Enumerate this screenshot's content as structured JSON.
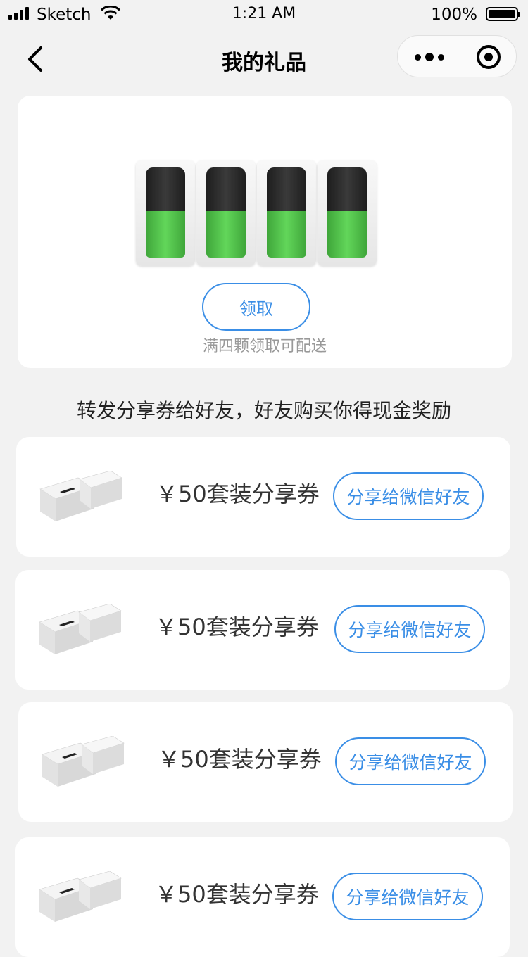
{
  "status_bar": {
    "carrier": "Sketch",
    "time": "1:21 AM",
    "battery": "100%"
  },
  "nav": {
    "title": "我的礼品",
    "back_icon": "chevron-left-icon",
    "more_icon": "more-dots-icon",
    "close_icon": "target-icon"
  },
  "gift": {
    "pod_count": 4,
    "claim_label": "领取",
    "claim_note": "满四颗领取可配送"
  },
  "promo_text": "转发分享券给好友，好友购买你得现金奖励",
  "coupons": [
    {
      "title": "￥50套装分享券",
      "button": "分享给微信好友"
    },
    {
      "title": "￥50套装分享券",
      "button": "分享给微信好友"
    },
    {
      "title": "￥50套装分享券",
      "button": "分享给微信好友"
    },
    {
      "title": "￥50套装分享券",
      "button": "分享给微信好友"
    }
  ],
  "colors": {
    "accent": "#3a8ee6",
    "background": "#f2f2f2",
    "card": "#ffffff",
    "muted_text": "#999999"
  }
}
